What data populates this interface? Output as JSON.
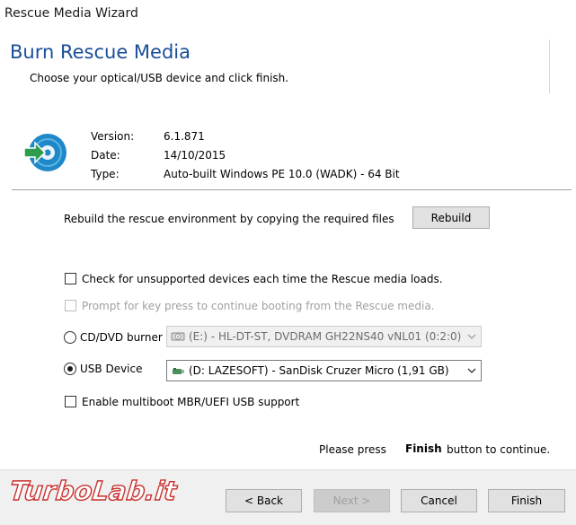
{
  "window": {
    "title": "Rescue Media Wizard"
  },
  "header": {
    "title": "Burn Rescue Media",
    "subtitle": "Choose your optical/USB device and click finish."
  },
  "info": {
    "version_label": "Version:",
    "version_value": "6.1.871",
    "date_label": "Date:",
    "date_value": "14/10/2015",
    "type_label": "Type:",
    "type_value": "Auto-built Windows PE 10.0 (WADK) - 64 Bit"
  },
  "rebuild": {
    "text": "Rebuild the rescue environment by copying the required files",
    "button": "Rebuild"
  },
  "options": {
    "check_unsupported": {
      "label": "Check for unsupported devices each time the Rescue media loads.",
      "checked": false
    },
    "prompt_keypress": {
      "label": "Prompt for key press to continue booting from the Rescue media.",
      "checked": false,
      "disabled": true
    },
    "cd_dvd": {
      "label": "CD/DVD burner",
      "selected": false,
      "device": "(E:) - HL-DT-ST, DVDRAM GH22NS40  vNL01 (0:2:0)"
    },
    "usb": {
      "label": "USB Device",
      "selected": true,
      "device": "(D: LAZESOFT) - SanDisk Cruzer Micro (1,91 GB)"
    },
    "multiboot": {
      "label": "Enable multiboot MBR/UEFI USB support",
      "checked": false
    }
  },
  "hint": {
    "prefix": "Please press",
    "bold": "Finish",
    "suffix": "button to continue."
  },
  "watermark": "TurboLab.it",
  "footer": {
    "back": "< Back",
    "next": "Next >",
    "cancel": "Cancel",
    "finish": "Finish"
  },
  "colors": {
    "title_blue": "#1a4e97",
    "cd_icon": "#1e88c8",
    "arrow_green": "#2e9e4e"
  }
}
